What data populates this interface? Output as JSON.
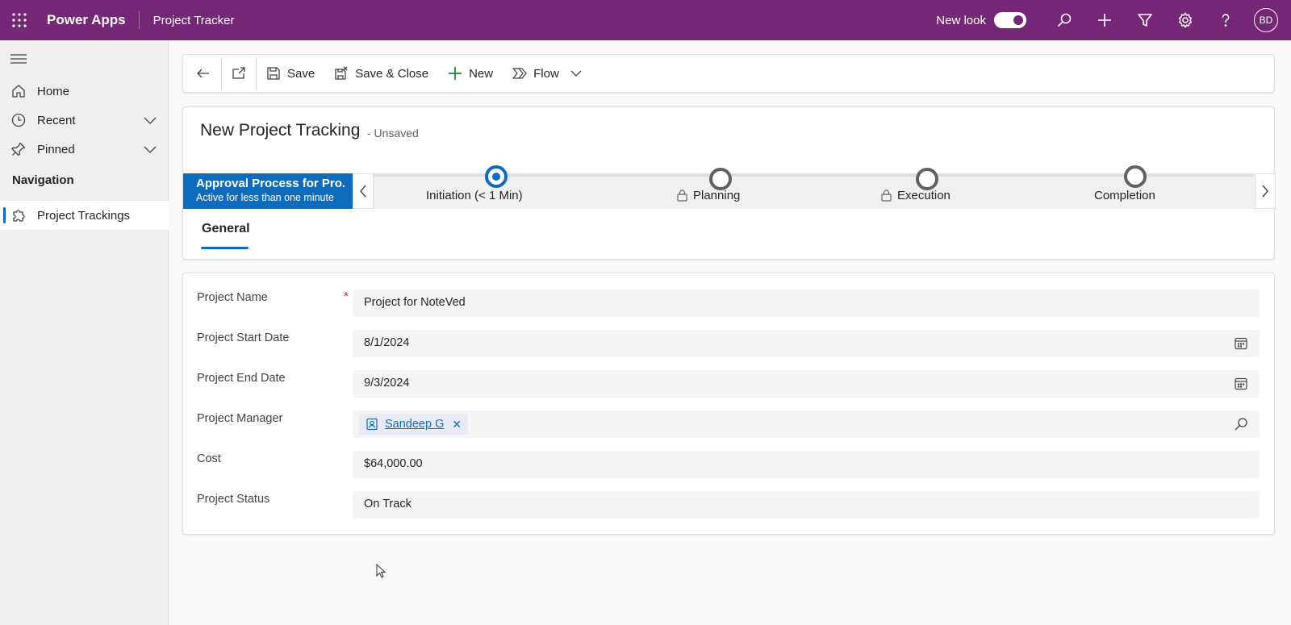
{
  "topbar": {
    "brand": "Power Apps",
    "app_name": "Project Tracker",
    "new_look_label": "New look",
    "new_look_on": true,
    "avatar_initials": "BD",
    "icons": [
      "waffle-icon",
      "search-icon",
      "plus-icon",
      "filter-icon",
      "gear-icon",
      "help-icon"
    ],
    "color": "#742774"
  },
  "sidebar": {
    "items": [
      {
        "label": "Home",
        "icon": "home-icon"
      },
      {
        "label": "Recent",
        "icon": "clock-icon",
        "expandable": true
      },
      {
        "label": "Pinned",
        "icon": "pin-icon",
        "expandable": true
      }
    ],
    "section_title": "Navigation",
    "nav_items": [
      {
        "label": "Project Trackings",
        "icon": "puzzle-icon",
        "active": true
      }
    ]
  },
  "commandbar": {
    "save": "Save",
    "save_close": "Save & Close",
    "new": "New",
    "flow": "Flow"
  },
  "record": {
    "title": "New Project Tracking",
    "status": "- Unsaved"
  },
  "bpf": {
    "active_name": "Approval Process for Pro...",
    "active_sub": "Active for less than one minute",
    "stages": [
      {
        "label": "Initiation  (< 1 Min)",
        "current": true,
        "locked": false
      },
      {
        "label": "Planning",
        "current": false,
        "locked": true
      },
      {
        "label": "Execution",
        "current": false,
        "locked": true
      },
      {
        "label": "Completion",
        "current": false,
        "locked": false
      }
    ]
  },
  "tabs": [
    "General"
  ],
  "form": {
    "fields": [
      {
        "label": "Project Name",
        "value": "Project for NoteVed",
        "required": true
      },
      {
        "label": "Project Start Date",
        "value": "8/1/2024",
        "icon": "calendar-icon"
      },
      {
        "label": "Project End Date",
        "value": "9/3/2024",
        "icon": "calendar-icon"
      },
      {
        "label": "Project Manager",
        "value": "Sandeep G",
        "type": "lookup",
        "icon": "search-icon"
      },
      {
        "label": "Cost",
        "value": "$64,000.00"
      },
      {
        "label": "Project Status",
        "value": "On Track"
      }
    ],
    "required_marker": "*"
  },
  "accent": "#0f6cbd"
}
